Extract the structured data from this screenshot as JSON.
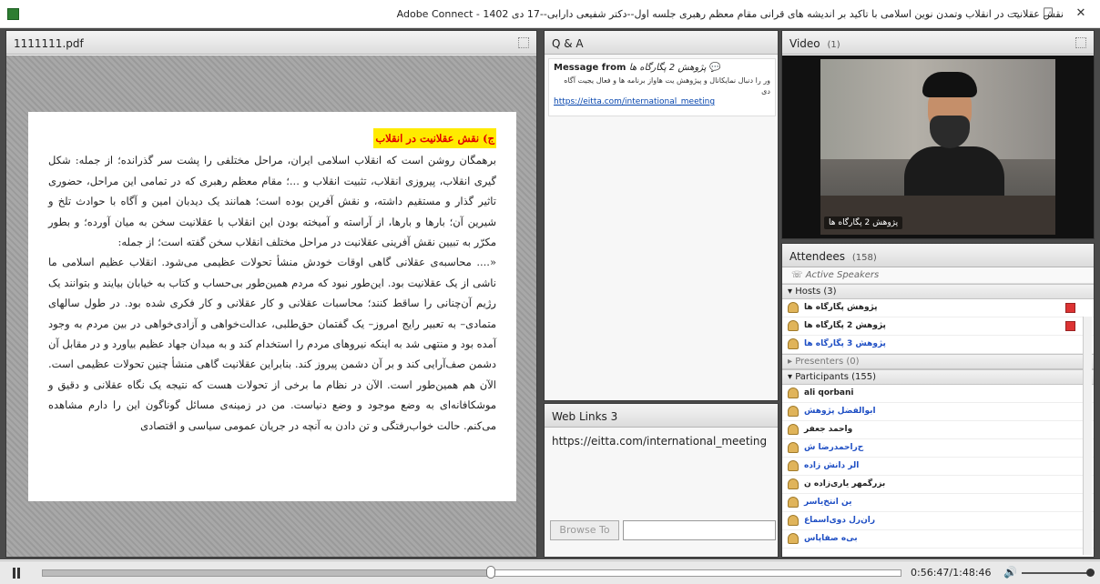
{
  "window": {
    "title": "نقش عقلانیت در انقلاب وتمدن نوین اسلامی با تاکید بر اندیشه های قرانی مقام معظم رهبری جلسه اول--دکتر شفیعی دارابی--17 دی 1402 - Adobe Connect",
    "min_label": "–",
    "max_label": "☐",
    "close_label": "✕"
  },
  "pdf_pod": {
    "title": "1111111.pdf",
    "heading": "ج) نقش عقلانیت در انقلاب",
    "para1": "برهمگان روشن است که انقلاب اسلامی ایران، مراحل مختلفی را پشت سر گذرانده؛ از جمله: شکل گیری انقلاب، پیروزی انقلاب، تثبیت انقلاب و ...؛ مقام معظم رهبری که در تمامی این مراحل، حضوری تاثیر گذار و مستقیم داشته، و نقش آفرین بوده است؛ همانند یک دیدبان امین و آگاه با حوادث تلخ و شیرین آن؛ بارها و بارها، از آراسته و آمیخته بودن این انقلاب با عقلانیت سخن به میان آورده؛ و بطور مکرّر به تبیین نقش آفرینی عقلانیت در مراحل مختلف انقلاب سخن گفته است؛ از جمله:",
    "para2": "«.... محاسبه‌ی عقلانی گاهی اوقات خودش منشأ تحولات عظیمی می‌شود. انقلاب عظیم اسلامی ما ناشی از یک عقلانیت بود. این‌طور نبود که مردم همین‌طور بی‌حساب و کتاب به خیابان بیایند و بتوانند یک رژیم آن‌چنانی را ساقط کنند؛ محاسبات عقلانی و کار عقلانی و کار فکری شده بود. در طول سالهای متمادی– به تعبیر رایج امروز– یک گفتمان حق‌طلبی، عدالت‌خواهی و آزادی‌خواهی در بین مردم به وجود آمده بود و منتهی شد به اینکه نیروهای مردم را استخدام کند و به میدان جهاد عظیم بیاورد و در مقابل آن دشمن صف‌آرایی کند و بر آن دشمن پیروز کند. بنابراین عقلانیت گاهی منشأ چنین تحولات عظیمی است. الآن هم همین‌طور است. الآن در نظام ما برخی از تحولات هست که نتیجه یک نگاه عقلانی و دقیق و موشکافانه‌ای به وضع موجود و وضع دنیاست. من در زمینه‌ی مسائل گوناگون این را دارم مشاهده می‌کنم. حالت خواب‌رفتگی و تن دادن به آنچه در جریان عمومی سیاسی و اقتصادی"
  },
  "qa_pod": {
    "title": "Q & A",
    "message_from": "Message from",
    "sender": "پژوهش 2 پگارگاه ها",
    "body": "ور را دنبال نمایکانال و پیژوهش یت هاواز برنامه ها و فعال یجیت آگاه دی",
    "link": "https://eitta.com/international_meeting"
  },
  "weblinks_pod": {
    "title": "Web Links",
    "count": "3",
    "link": "https://eitta.com/international_meeting",
    "browse_label": "Browse To",
    "url_value": ""
  },
  "video_pod": {
    "title": "Video",
    "count": "(1)",
    "caption": "پژوهش 2 پگارگاه ها"
  },
  "attendees_pod": {
    "title": "Attendees",
    "count": "(158)",
    "active_speakers": "Active Speakers",
    "hosts_label": "Hosts (3)",
    "hosts": [
      {
        "name": "پژوهش پگارگاه ها",
        "blue": false
      },
      {
        "name": "پژوهش 2 پگارگاه ها",
        "blue": false
      },
      {
        "name": "پژوهش 3 پگارگاه ها",
        "blue": true
      }
    ],
    "presenters_label": "Presenters (0)",
    "participants_label": "Participants (155)",
    "participants": [
      {
        "name": "ali qorbani",
        "blue": false
      },
      {
        "name": "ابوالفضل پژوهش",
        "blue": true
      },
      {
        "name": "واحمد جعفر",
        "blue": false
      },
      {
        "name": "ح‌راحمدرضا ش",
        "blue": true
      },
      {
        "name": "الر دانش زاده",
        "blue": true
      },
      {
        "name": "بزرگمهر یاری‌زاده ن",
        "blue": false
      },
      {
        "name": "ین انتخ‌یاسر",
        "blue": true
      },
      {
        "name": "ران‌رل دوی‌اسماع",
        "blue": true
      },
      {
        "name": "بی‌ه صفاپاس",
        "blue": true
      }
    ]
  },
  "playback": {
    "timecode": "0:56:47/1:48:46",
    "progress": 0.522,
    "volume": 1.0
  }
}
